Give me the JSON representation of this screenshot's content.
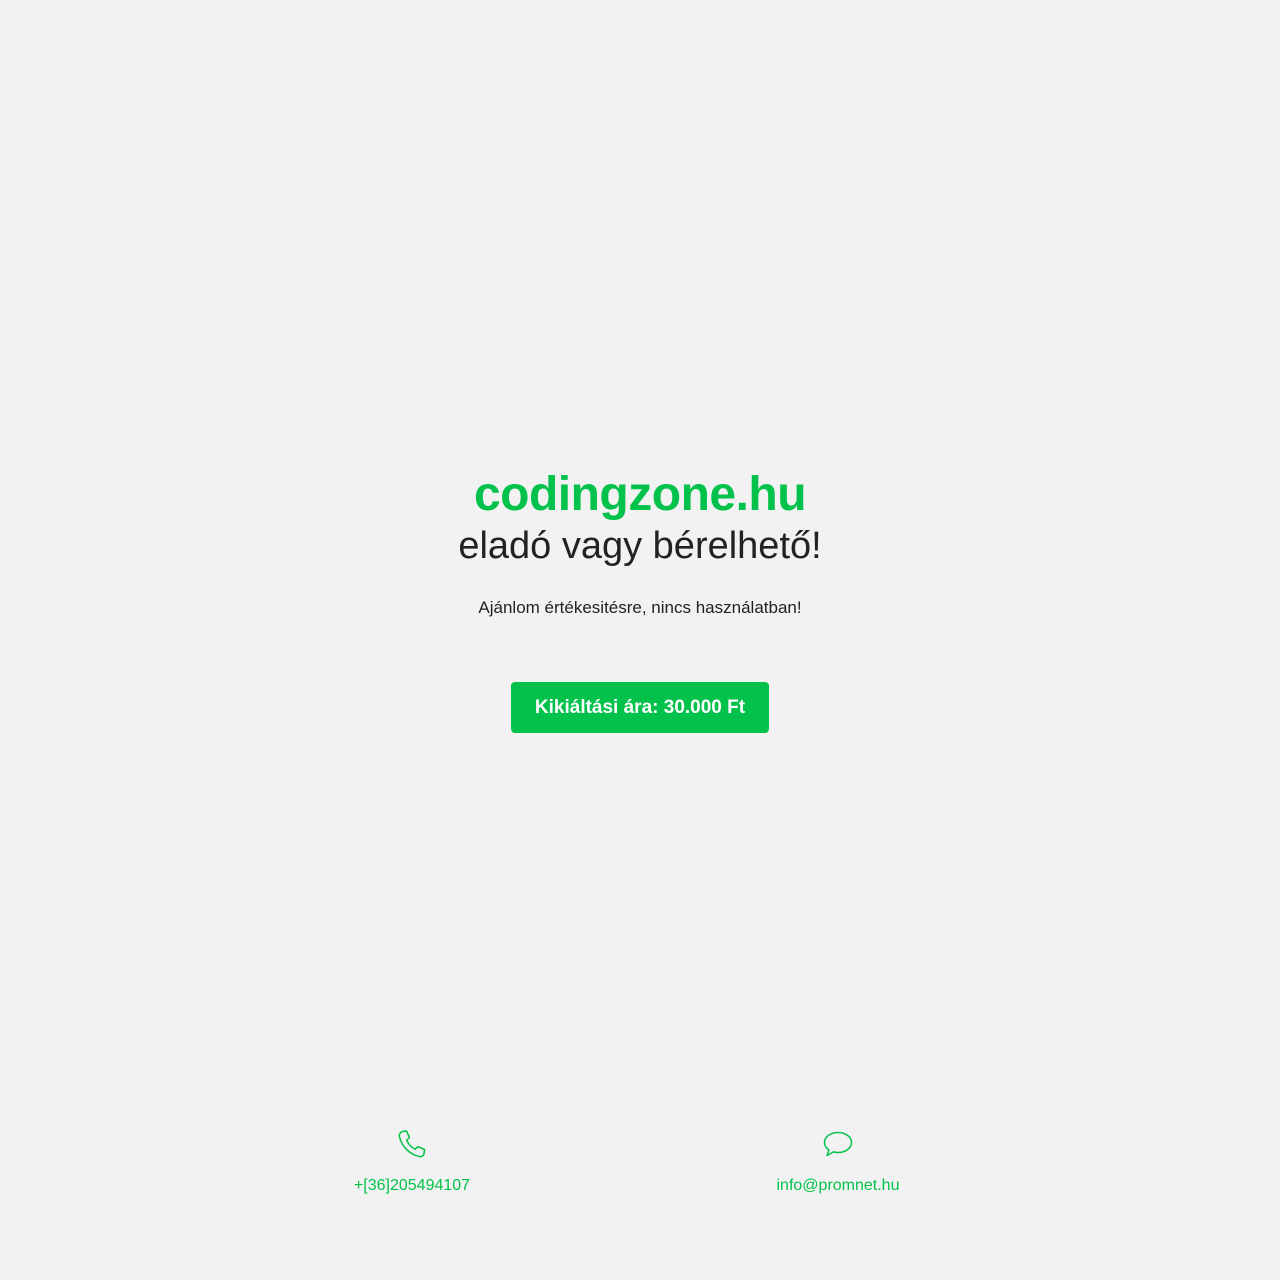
{
  "hero": {
    "domain": "codingzone.hu",
    "subtitle": "eladó vagy bérelhető!",
    "tagline": "Ajánlom értékesitésre, nincs használatban!"
  },
  "cta": {
    "label": "Kikiáltási ára: 30.000 Ft"
  },
  "contacts": {
    "phone": {
      "icon": "phone-icon",
      "text": "+[36]205494107"
    },
    "email": {
      "icon": "chat-bubble-icon",
      "text": "info@promnet.hu"
    }
  },
  "colors": {
    "accent": "#03c24b",
    "background": "#f2f2f2",
    "text": "#222222",
    "button_text": "#ffffff"
  }
}
